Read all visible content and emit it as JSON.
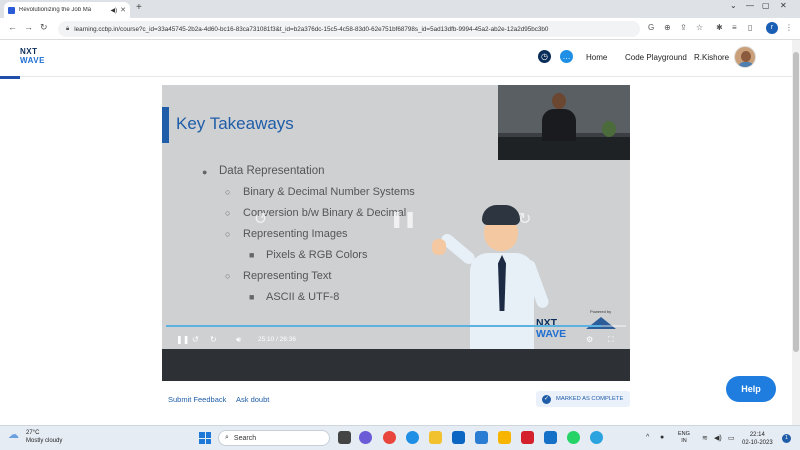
{
  "browser": {
    "tab_title": "Revolutionizing the Job Ma",
    "new_tab": "+",
    "url": "learning.ccbp.in/course?c_id=33a45745-2b2a-4d60-bc16-83ca731081f3&t_id=b2a376dc-15c5-4c58-83d0-62e751bf68798s_id=5ad13dfb-9994-45a2-ab2e-12a2d95bc3b0",
    "profile_initial": "r"
  },
  "header": {
    "logo_line1": "NXT",
    "logo_line2": "WAVE",
    "nav_home": "Home",
    "nav_code_playground": "Code Playground",
    "user_name": "R.Kishore"
  },
  "video": {
    "slide_title": "Key Takeaways",
    "bullets": [
      "Data Representation",
      "Binary & Decimal Number Systems",
      "Conversion b/w Binary & Decimal",
      "Representing Images",
      "Pixels & RGB Colors",
      "Representing Text",
      "ASCII & UTF-8"
    ],
    "brand_logo_line1": "NXT",
    "brand_logo_line2": "WAVE",
    "powered_by": "Powered by",
    "current_time": "25:10",
    "duration": "26:36",
    "time_display": "25:10 / 26:36",
    "progress_fraction": 0.946
  },
  "actions": {
    "submit_feedback": "Submit Feedback",
    "ask_doubt": "Ask doubt",
    "marked_complete": "MARKED AS COMPLETE",
    "help": "Help"
  },
  "taskbar": {
    "temperature": "27°C",
    "weather": "Mostly cloudy",
    "search_placeholder": "Search",
    "lang_line1": "ENG",
    "lang_line2": "IN",
    "time": "22:14",
    "date": "02-10-2023",
    "notification_count": "1"
  }
}
